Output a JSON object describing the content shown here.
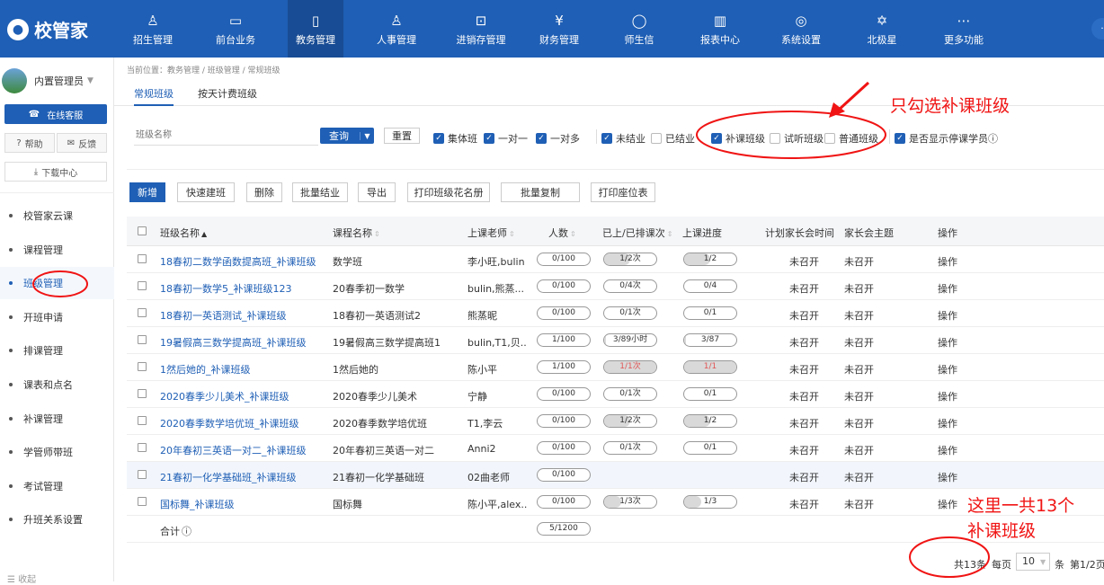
{
  "brand": {
    "name": "校管家"
  },
  "nav": [
    {
      "label": "招生管理",
      "icon": "user-plus-icon",
      "glyph": "♙"
    },
    {
      "label": "前台业务",
      "icon": "screen-icon",
      "glyph": "▭"
    },
    {
      "label": "教务管理",
      "icon": "book-icon",
      "glyph": "▯"
    },
    {
      "label": "人事管理",
      "icon": "person-icon",
      "glyph": "♙"
    },
    {
      "label": "进销存管理",
      "icon": "inbox-icon",
      "glyph": "⊡"
    },
    {
      "label": "财务管理",
      "icon": "money-bag-icon",
      "glyph": "¥"
    },
    {
      "label": "师生信",
      "icon": "chat-icon",
      "glyph": "◯"
    },
    {
      "label": "报表中心",
      "icon": "chart-icon",
      "glyph": "▥"
    },
    {
      "label": "系统设置",
      "icon": "gear-icon",
      "glyph": "◎"
    },
    {
      "label": "北极星",
      "icon": "star-icon",
      "glyph": "✡"
    },
    {
      "label": "更多功能",
      "icon": "more-icon",
      "glyph": "⋯"
    }
  ],
  "sidebar": {
    "user": "内置管理员",
    "online_service": "在线客服",
    "help": "帮助",
    "feedback": "反馈",
    "download": "下载中心",
    "items": [
      "校管家云课",
      "课程管理",
      "班级管理",
      "开班申请",
      "排课管理",
      "课表和点名",
      "补课管理",
      "学管师带班",
      "考试管理",
      "升班关系设置"
    ],
    "collapse": "收起"
  },
  "breadcrumb": "当前位置：教务管理 / 班级管理 / 常规班级",
  "tabs": [
    "常规班级",
    "按天计费班级"
  ],
  "filters": {
    "search_placeholder": "班级名称",
    "query": "查询",
    "reset": "重置",
    "checkboxes": [
      {
        "label": "集体班",
        "checked": true
      },
      {
        "label": "一对一",
        "checked": true
      },
      {
        "label": "一对多",
        "checked": true
      },
      {
        "label": "未结业",
        "checked": true
      },
      {
        "label": "已结业",
        "checked": false
      },
      {
        "label": "补课班级",
        "checked": true
      },
      {
        "label": "试听班级",
        "checked": false
      },
      {
        "label": "普通班级",
        "checked": false
      },
      {
        "label": "是否显示停课学员",
        "checked": true
      }
    ]
  },
  "actions": [
    "新增",
    "快速建班",
    "删除",
    "批量结业",
    "导出",
    "打印班级花名册",
    "批量复制",
    "打印座位表"
  ],
  "table": {
    "headers": [
      "班级名称",
      "课程名称",
      "上课老师",
      "人数",
      "已上/已排课次",
      "上课进度",
      "计划家长会时间",
      "家长会主题",
      "操作"
    ],
    "rows": [
      {
        "name": "18春初二数学函数提高班_补课班级",
        "course": "数学班",
        "teacher": "李小旺,bulin",
        "count": "0/100",
        "sessions": "1/2次",
        "sessions_frac": 0.5,
        "progress": "1/2",
        "progress_frac": 0.5,
        "meeting": "未召开",
        "topic": "未召开",
        "op": "操作",
        "red": false
      },
      {
        "name": "18春初一数学5_补课班级123",
        "course": "20春季初一数学",
        "teacher": "bulin,熊蒸...",
        "count": "0/100",
        "sessions": "0/4次",
        "sessions_frac": 0,
        "progress": "0/4",
        "progress_frac": 0,
        "meeting": "未召开",
        "topic": "未召开",
        "op": "操作",
        "red": false
      },
      {
        "name": "18春初一英语测试_补课班级",
        "course": "18春初一英语测试2",
        "teacher": "熊蒸昵",
        "count": "0/100",
        "sessions": "0/1次",
        "sessions_frac": 0,
        "progress": "0/1",
        "progress_frac": 0,
        "meeting": "未召开",
        "topic": "未召开",
        "op": "操作",
        "red": false
      },
      {
        "name": "19暑假高三数学提高班_补课班级",
        "course": "19暑假高三数学提高班1",
        "teacher": "bulin,T1,贝...",
        "count": "1/100",
        "sessions": "3/89小时",
        "sessions_frac": 0.034,
        "progress": "3/87",
        "progress_frac": 0.034,
        "meeting": "未召开",
        "topic": "未召开",
        "op": "操作",
        "red": false
      },
      {
        "name": "1然后她的_补课班级",
        "course": "1然后她的",
        "teacher": "陈小平",
        "count": "1/100",
        "sessions": "1/1次",
        "sessions_frac": 1,
        "progress": "1/1",
        "progress_frac": 1,
        "meeting": "未召开",
        "topic": "未召开",
        "op": "操作",
        "red": true
      },
      {
        "name": "2020春季少儿美术_补课班级",
        "course": "2020春季少儿美术",
        "teacher": "宁静",
        "count": "0/100",
        "sessions": "0/1次",
        "sessions_frac": 0,
        "progress": "0/1",
        "progress_frac": 0,
        "meeting": "未召开",
        "topic": "未召开",
        "op": "操作",
        "red": false
      },
      {
        "name": "2020春季数学培优班_补课班级",
        "course": "2020春季数学培优班",
        "teacher": "T1,李云",
        "count": "0/100",
        "sessions": "1/2次",
        "sessions_frac": 0.5,
        "progress": "1/2",
        "progress_frac": 0.5,
        "meeting": "未召开",
        "topic": "未召开",
        "op": "操作",
        "red": false
      },
      {
        "name": "20年春初三英语一对二_补课班级",
        "course": "20年春初三英语一对二",
        "teacher": "Anni2",
        "count": "0/100",
        "sessions": "0/1次",
        "sessions_frac": 0,
        "progress": "0/1",
        "progress_frac": 0,
        "meeting": "未召开",
        "topic": "未召开",
        "op": "操作",
        "red": false
      },
      {
        "name": "21春初一化学基础班_补课班级",
        "course": "21春初一化学基础班",
        "teacher": "02曲老师",
        "count": "0/100",
        "sessions": "",
        "sessions_frac": 0,
        "progress": "",
        "progress_frac": 0,
        "meeting": "未召开",
        "topic": "未召开",
        "op": "操作",
        "red": false
      },
      {
        "name": "国标舞_补课班级",
        "course": "国标舞",
        "teacher": "陈小平,alex...",
        "count": "0/100",
        "sessions": "1/3次",
        "sessions_frac": 0.333,
        "progress": "1/3",
        "progress_frac": 0.333,
        "meeting": "未召开",
        "topic": "未召开",
        "op": "操作",
        "red": false
      }
    ],
    "total_label": "合计",
    "total_count": "5/1200"
  },
  "pager": {
    "total": "共13条",
    "per_page": "每页",
    "size": "10",
    "unit": "条",
    "page": "第1/2页"
  },
  "annotations": {
    "top": "只勾选补课班级",
    "bottom_line1": "这里一共13个",
    "bottom_line2": "补课班级"
  },
  "colors": {
    "primary": "#1f5fb5",
    "annotation": "#f01414"
  }
}
